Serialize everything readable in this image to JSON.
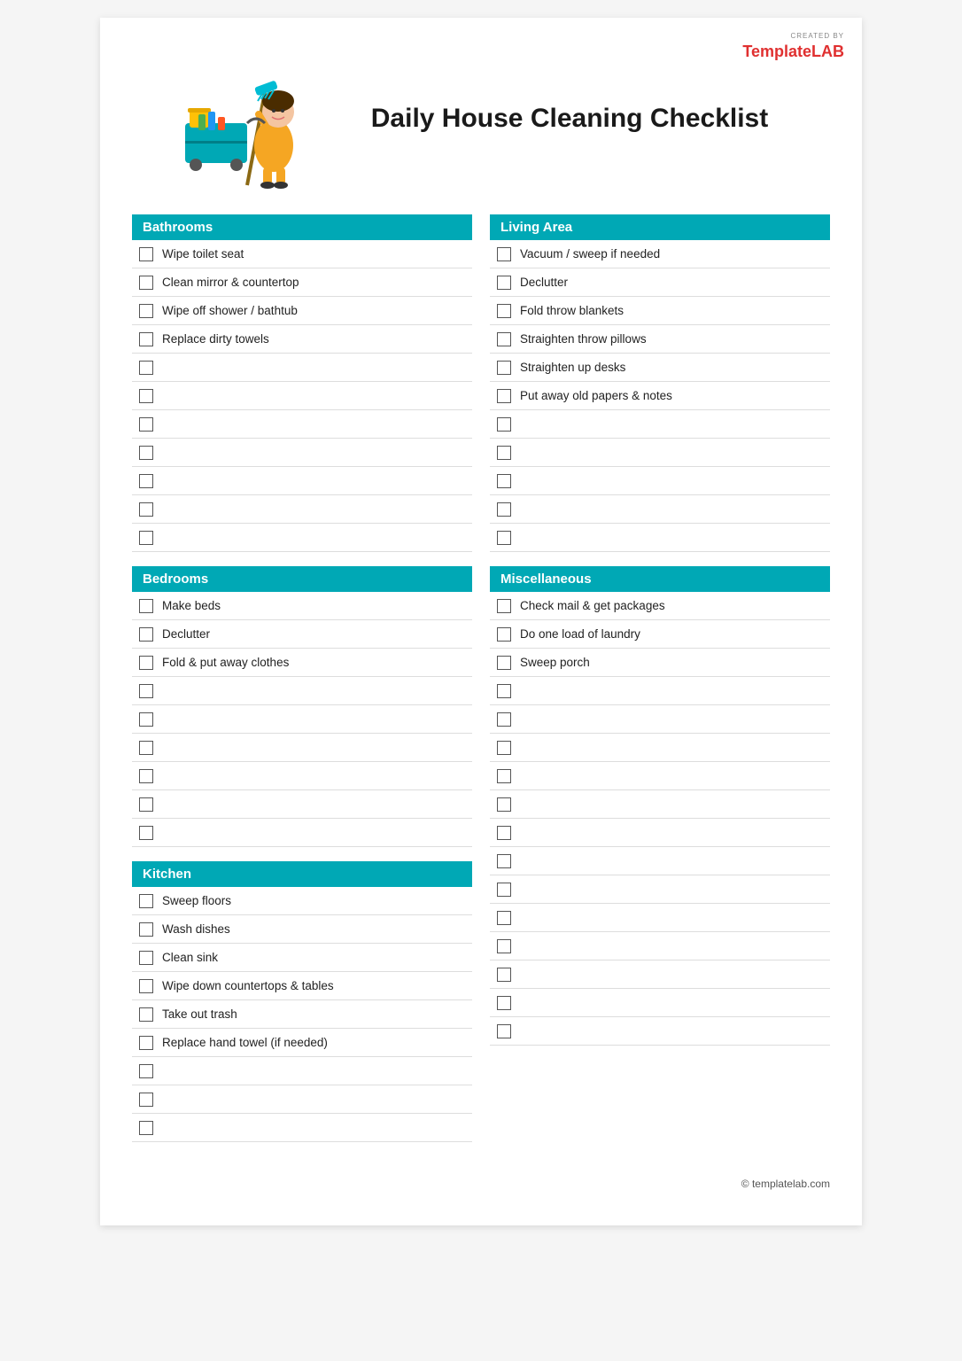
{
  "logo": {
    "created_by": "CREATED BY",
    "brand_template": "Template",
    "brand_lab": "LAB"
  },
  "title": "Daily House Cleaning Checklist",
  "sections": {
    "left": [
      {
        "id": "bathrooms",
        "header": "Bathrooms",
        "items": [
          "Wipe toilet seat",
          "Clean mirror & countertop",
          "Wipe off shower / bathtub",
          "Replace dirty towels",
          "",
          "",
          "",
          "",
          "",
          "",
          ""
        ]
      },
      {
        "id": "bedrooms",
        "header": "Bedrooms",
        "items": [
          "Make beds",
          "Declutter",
          "Fold & put away clothes",
          "",
          "",
          "",
          "",
          "",
          ""
        ]
      },
      {
        "id": "kitchen",
        "header": "Kitchen",
        "items": [
          "Sweep floors",
          "Wash dishes",
          "Clean sink",
          "Wipe down countertops & tables",
          "Take out trash",
          "Replace hand towel (if needed)",
          "",
          "",
          ""
        ]
      }
    ],
    "right": [
      {
        "id": "living-area",
        "header": "Living Area",
        "items": [
          "Vacuum / sweep if needed",
          "Declutter",
          "Fold throw blankets",
          "Straighten throw pillows",
          "Straighten up desks",
          "Put away old papers & notes",
          "",
          "",
          "",
          "",
          ""
        ]
      },
      {
        "id": "miscellaneous",
        "header": "Miscellaneous",
        "items": [
          "Check mail & get packages",
          "Do one load of laundry",
          "Sweep porch",
          "",
          "",
          "",
          "",
          "",
          "",
          "",
          "",
          "",
          "",
          "",
          "",
          ""
        ]
      }
    ]
  },
  "footer": "© templatelab.com"
}
